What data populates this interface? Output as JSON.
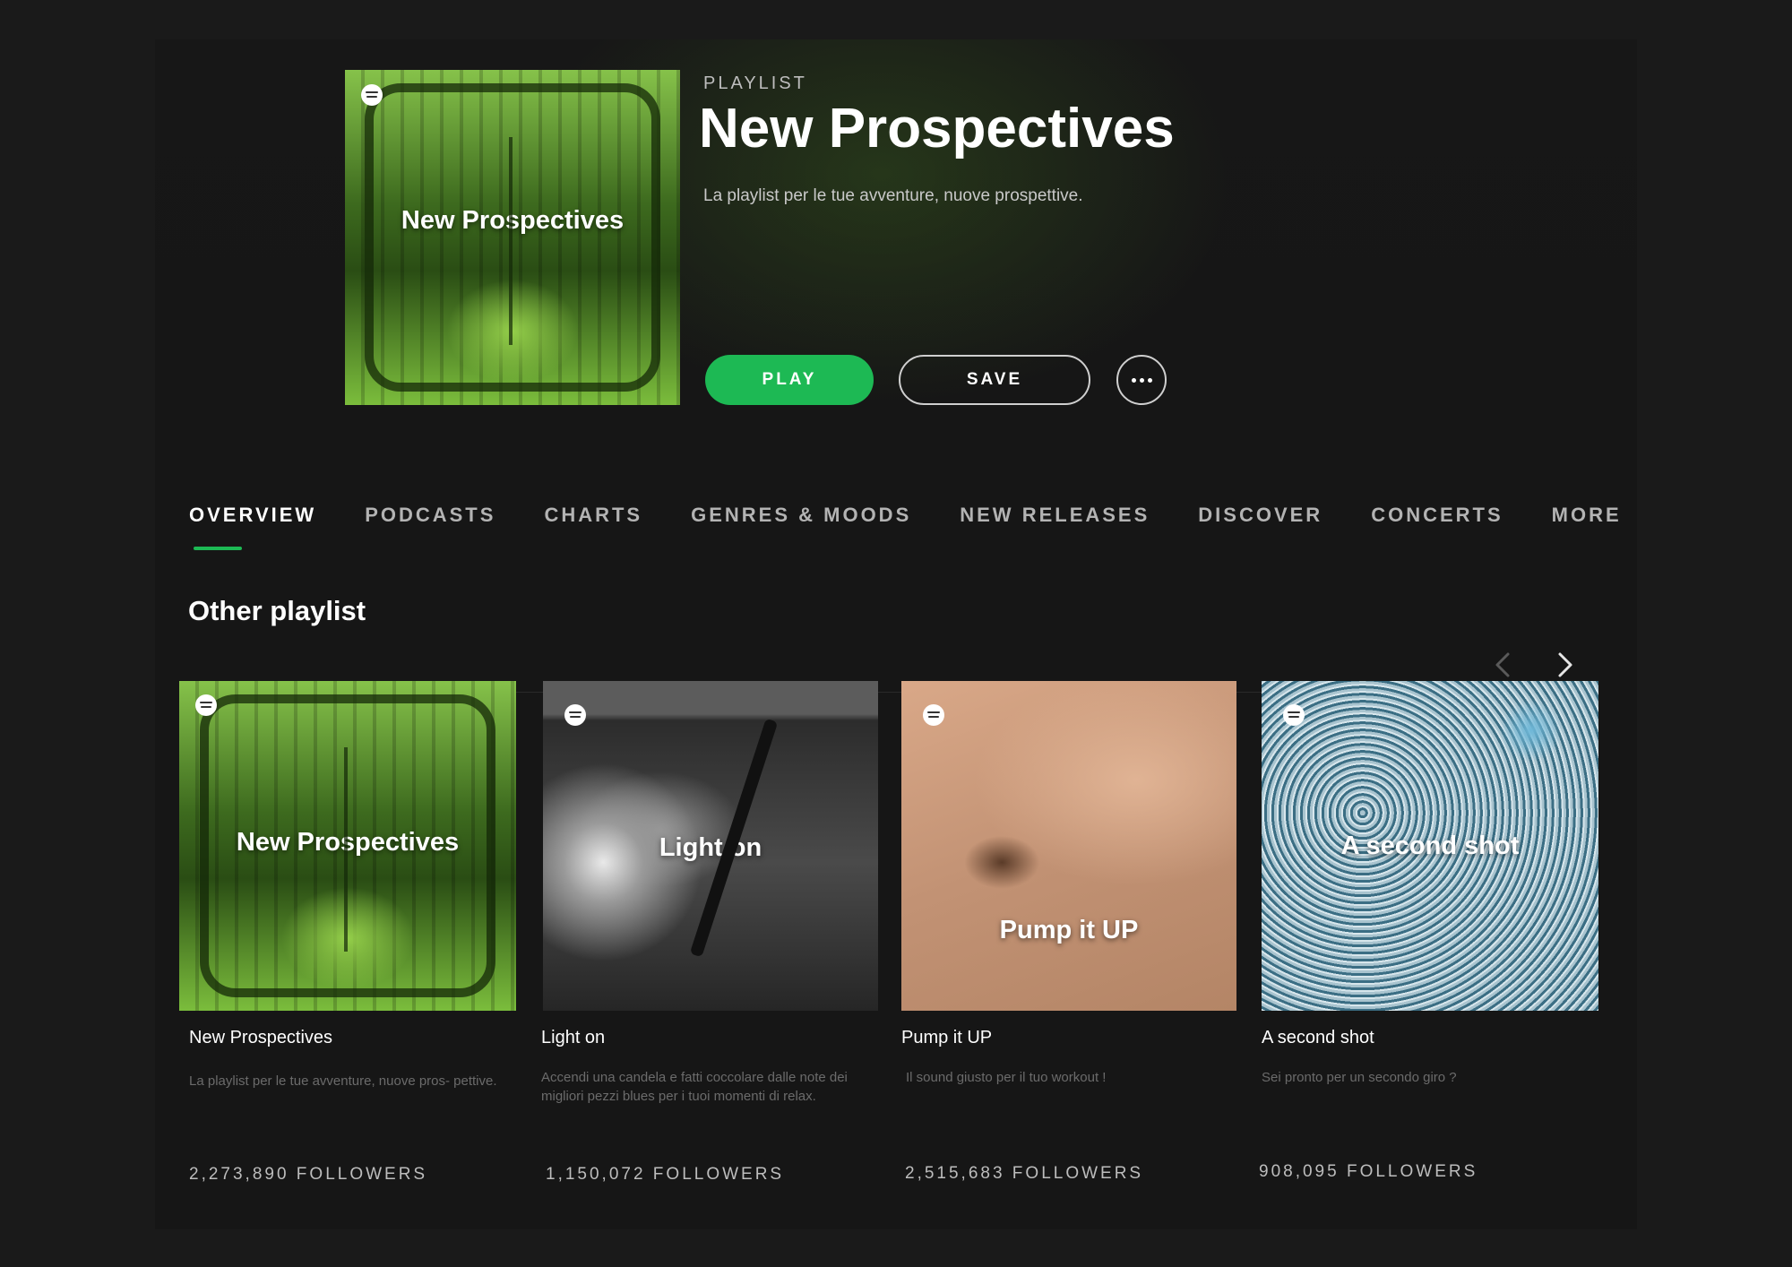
{
  "hero": {
    "type": "PLAYLIST",
    "title": "New Prospectives",
    "description": "La playlist per le tue avventure, nuove prospettive.",
    "cover_title": "New Prospectives",
    "play_label": "PLAY",
    "save_label": "SAVE"
  },
  "tabs": [
    {
      "label": "OVERVIEW",
      "active": true
    },
    {
      "label": "PODCASTS"
    },
    {
      "label": "CHARTS"
    },
    {
      "label": "GENRES & MOODS"
    },
    {
      "label": "NEW RELEASES"
    },
    {
      "label": "DISCOVER"
    },
    {
      "label": "CONCERTS"
    },
    {
      "label": "MORE"
    }
  ],
  "section": {
    "title": "Other playlist"
  },
  "playlists": [
    {
      "cover_title": "New Prospectives",
      "name": "New Prospectives",
      "description": "La playlist per le tue avventure, nuove pros- pettive.",
      "followers": "2,273,890 FOLLOWERS"
    },
    {
      "cover_title": "Light on",
      "name": "Light on",
      "description": "Accendi una candela e fatti coccolare dalle note dei migliori pezzi blues per i tuoi momenti di relax.",
      "followers": "1,150,072 FOLLOWERS"
    },
    {
      "cover_title": "Pump it UP",
      "name": "Pump it UP",
      "description": "Il sound giusto per il tuo workout !",
      "followers": "2,515,683 FOLLOWERS"
    },
    {
      "cover_title": "A second shot",
      "name": "A second shot",
      "description": "Sei pronto per un secondo giro ?",
      "followers": "908,095 FOLLOWERS"
    }
  ],
  "colors": {
    "accent": "#1db954",
    "background": "#161616"
  }
}
